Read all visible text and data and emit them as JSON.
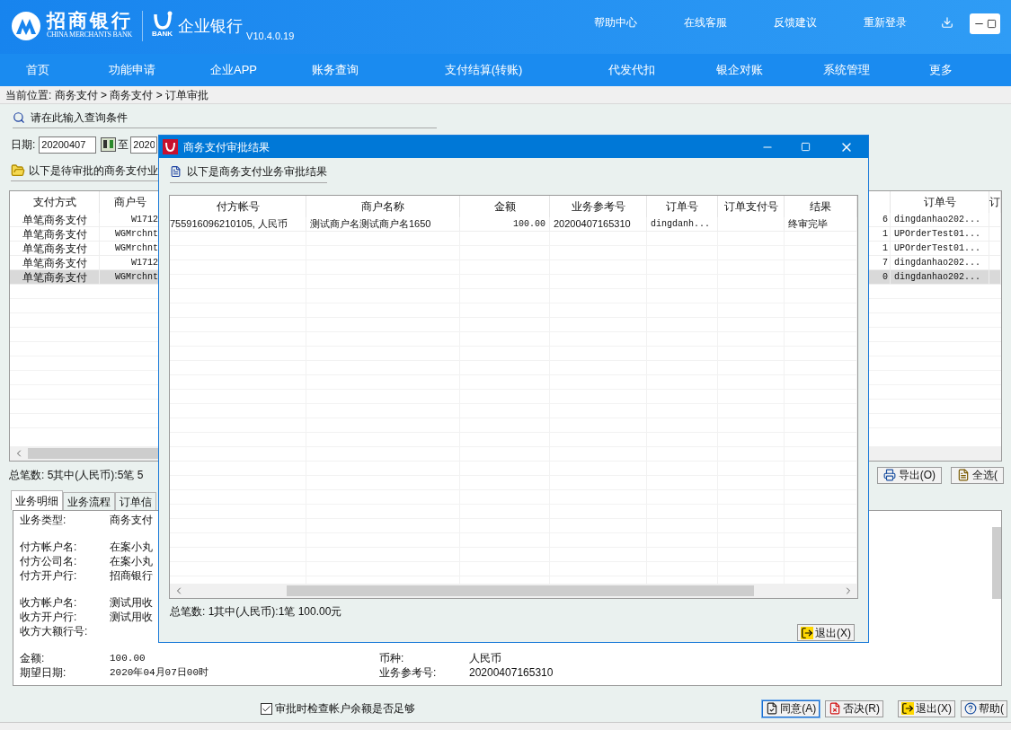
{
  "header": {
    "brand_name": "招商银行",
    "brand_en": "CHINA MERCHANTS BANK",
    "product_mark": "BANK",
    "product_name": "企业银行",
    "version": "V10.4.0.19",
    "top_links": [
      {
        "label": "帮助中心"
      },
      {
        "label": "在线客服"
      },
      {
        "label": "反馈建议"
      },
      {
        "label": "重新登录"
      }
    ]
  },
  "nav": [
    {
      "label": "首页"
    },
    {
      "label": "功能申请"
    },
    {
      "label": "企业APP"
    },
    {
      "label": "账务查询"
    },
    {
      "label": "支付结算(转账)"
    },
    {
      "label": "代发代扣"
    },
    {
      "label": "银企对账"
    },
    {
      "label": "系统管理"
    },
    {
      "label": "更多"
    }
  ],
  "breadcrumb": "当前位置: 商务支付 > 商务支付 > 订单审批",
  "query_title": "请在此输入查询条件",
  "date_filter": {
    "label": "日期:",
    "from": "20200407",
    "to_label": "至",
    "to": "2020"
  },
  "list_title": "以下是待审批的商务支付业",
  "main_table": {
    "columns": [
      {
        "label": "支付方式"
      },
      {
        "label": "商户号"
      },
      {},
      {
        "label": "订单号"
      },
      {
        "label": "订"
      }
    ],
    "rows": [
      {
        "cells": [
          "单笔商务支付",
          "W1712",
          "6",
          "dingdanhao202...",
          ""
        ],
        "selected": false
      },
      {
        "cells": [
          "单笔商务支付",
          "WGMrchnt",
          "1",
          "UPOrderTest01...",
          ""
        ],
        "selected": false
      },
      {
        "cells": [
          "单笔商务支付",
          "WGMrchnt",
          "1",
          "UPOrderTest01...",
          ""
        ],
        "selected": false
      },
      {
        "cells": [
          "单笔商务支付",
          "W1712",
          "7",
          "dingdanhao202...",
          ""
        ],
        "selected": false
      },
      {
        "cells": [
          "单笔商务支付",
          "WGMrchnt",
          "0",
          "dingdanhao202...",
          ""
        ],
        "selected": true
      }
    ]
  },
  "summary": "总笔数: 5其中(人民币):5笔  5",
  "actions": [
    {
      "label": "导出(O)",
      "kind": "export"
    },
    {
      "label": "全选(",
      "kind": "select"
    }
  ],
  "detail_tabs": [
    {
      "label": "业务明细",
      "selected": true
    },
    {
      "label": "业务流程",
      "selected": false
    },
    {
      "label": "订单信",
      "selected": false
    }
  ],
  "details": {
    "groups": [
      [
        {
          "label": "业务类型:",
          "value": "商务支付"
        }
      ],
      [
        {
          "label": "付方帐户名:",
          "value": "在案小丸"
        },
        {
          "label": "付方公司名:",
          "value": "在案小丸"
        },
        {
          "label": "付方开户行:",
          "value": "招商银行"
        }
      ],
      [
        {
          "label": "收方帐户名:",
          "value": "测试用收"
        },
        {
          "label": "收方开户行:",
          "value": "测试用收"
        },
        {
          "label": "收方大额行号:"
        }
      ],
      [
        {
          "label": "金额:",
          "value": "100.00"
        },
        {
          "label": "期望日期:",
          "value": "2020年04月07日00时"
        }
      ]
    ],
    "side": [
      {
        "label": "币种:",
        "value": "人民币"
      },
      {
        "label": "业务参考号:",
        "value": "20200407165310"
      }
    ]
  },
  "check": {
    "label": "审批时检查帐户余额是否足够",
    "checked": true
  },
  "bottom_buttons": [
    {
      "label": "同意(A)",
      "kind": "approve",
      "selected": true
    },
    {
      "label": "否决(R)",
      "kind": "reject",
      "selected": false
    },
    {
      "label": "退出(X)",
      "kind": "exit",
      "selected": false
    },
    {
      "label": "帮助(",
      "kind": "help",
      "selected": false
    }
  ],
  "dialog": {
    "title": "商务支付审批结果",
    "heading": "以下是商务支付业务审批结果",
    "columns": [
      {
        "label": "付方帐号"
      },
      {
        "label": "商户名称"
      },
      {
        "label": "金额"
      },
      {
        "label": "业务参考号"
      },
      {
        "label": "订单号"
      },
      {
        "label": "订单支付号"
      },
      {
        "label": "结果"
      }
    ],
    "rows": [
      {
        "cells": [
          "755916096210105, 人民币",
          "测试商户名测试商户名1650",
          "100.00",
          "20200407165310",
          "dingdanh...",
          "",
          "终审完毕"
        ]
      }
    ],
    "summary": "总笔数: 1其中(人民币):1笔  100.00元",
    "exit_button": "退出(X)"
  }
}
